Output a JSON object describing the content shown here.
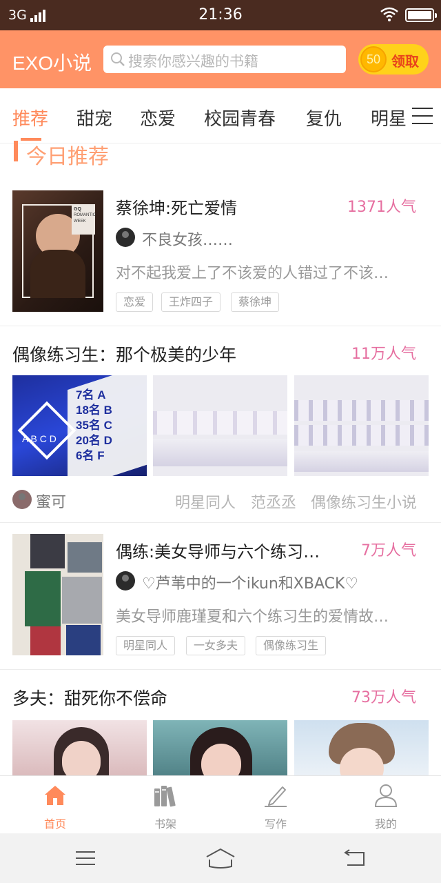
{
  "status_bar": {
    "carrier": "3G",
    "time": "21:36"
  },
  "header": {
    "app_title": "EXO小说",
    "search_placeholder": "搜索你感兴趣的书籍",
    "claim": {
      "coin_value": "50",
      "label": "领取"
    }
  },
  "tabs": [
    "推荐",
    "甜宠",
    "恋爱",
    "校园青春",
    "复仇",
    "明星"
  ],
  "section": {
    "title": "今日推荐"
  },
  "books": [
    {
      "title": "蔡徐坤:死亡爱情",
      "popularity": "1371人气",
      "author": "不良女孩……",
      "description": "对不起我爱上了不该爱的人错过了不该…",
      "tags": [
        "恋爱",
        "王炸四子",
        "蔡徐坤"
      ],
      "cover_text": {
        "line1": "GQ",
        "line2": "ROMANTIC",
        "line3": "WEEK"
      }
    },
    {
      "title": "偶像练习生：那个极美的少年",
      "popularity": "11万人气",
      "author": "蜜可",
      "tags": [
        "明星同人",
        "范丞丞",
        "偶像练习生小说"
      ],
      "thumb_text": {
        "rank_letters": [
          "A",
          "B",
          "C",
          "D"
        ],
        "ranks": [
          "7名",
          "18名",
          "35名",
          "20名",
          "6名"
        ],
        "suffix": [
          "A",
          "B",
          "C",
          "D",
          "F"
        ]
      }
    },
    {
      "title": "偶练:美女导师与六个练习…",
      "popularity": "7万人气",
      "author": "♡芦苇中的一个ikun和XBACK♡",
      "description": "美女导师鹿瑾夏和六个练习生的爱情故…",
      "tags": [
        "明星同人",
        "一女多夫",
        "偶像练习生"
      ]
    },
    {
      "title": "多夫：甜死你不偿命",
      "popularity": "73万人气"
    }
  ],
  "bottom_nav": [
    {
      "label": "首页",
      "icon": "home-icon",
      "active": true
    },
    {
      "label": "书架",
      "icon": "bookshelf-icon",
      "active": false
    },
    {
      "label": "写作",
      "icon": "pen-icon",
      "active": false
    },
    {
      "label": "我的",
      "icon": "user-icon",
      "active": false
    }
  ],
  "colors": {
    "status_bar": "#4a2b20",
    "header": "#ff9366",
    "accent": "#ff8a5b",
    "popularity": "#e66fa0"
  }
}
